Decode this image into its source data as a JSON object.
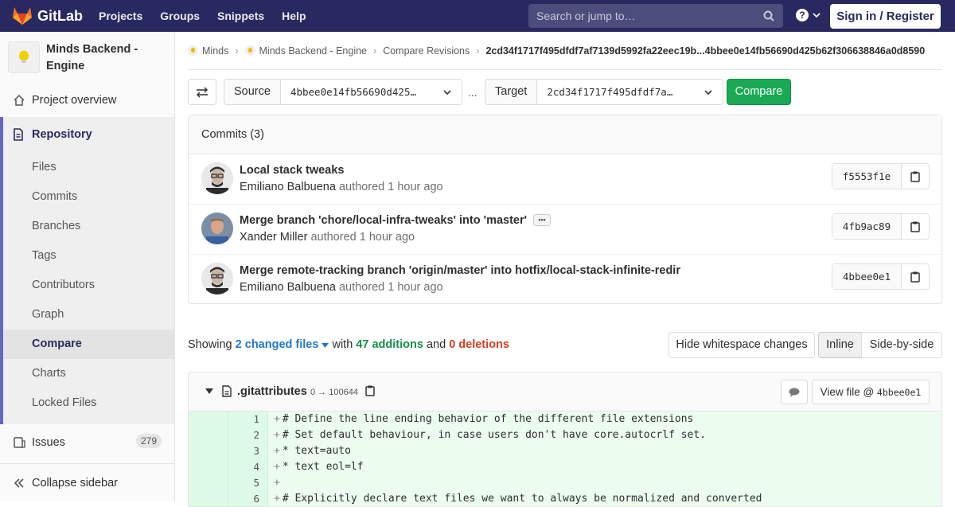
{
  "navbar": {
    "brand": "GitLab",
    "links": [
      "Projects",
      "Groups",
      "Snippets",
      "Help"
    ],
    "search_placeholder": "Search or jump to…",
    "help_label": "?",
    "signin_label": "Sign in / Register"
  },
  "sidebar": {
    "project_name": "Minds Backend - Engine",
    "project_overview": "Project overview",
    "repository": "Repository",
    "repo_items": [
      "Files",
      "Commits",
      "Branches",
      "Tags",
      "Contributors",
      "Graph",
      "Compare",
      "Charts",
      "Locked Files"
    ],
    "active_item": "Compare",
    "issues": "Issues",
    "issues_count": "279",
    "collapse": "Collapse sidebar"
  },
  "breadcrumb": {
    "items": [
      "Minds",
      "Minds Backend - Engine",
      "Compare Revisions"
    ],
    "current": "2cd34f1717f495dfdf7af7139d5992fa22eec19b...4bbee0e14fb56690d425b62f306638846a0d8590"
  },
  "compare": {
    "source_label": "Source",
    "source_value": "4bbee0e14fb56690d425…",
    "dots": "...",
    "target_label": "Target",
    "target_value": "2cd34f1717f495dfdf7a…",
    "button": "Compare"
  },
  "commits": {
    "header": "Commits (3)",
    "rows": [
      {
        "title": "Local stack tweaks",
        "author": "Emiliano Balbuena",
        "authored": "authored",
        "time": "1 hour ago",
        "sha": "f5553f1e",
        "has_more": false
      },
      {
        "title": "Merge branch 'chore/local-infra-tweaks' into 'master'",
        "author": "Xander Miller",
        "authored": "authored",
        "time": "1 hour ago",
        "sha": "4fb9ac89",
        "has_more": true
      },
      {
        "title": "Merge remote-tracking branch 'origin/master' into hotfix/local-stack-infinite-redir",
        "author": "Emiliano Balbuena",
        "authored": "authored",
        "time": "1 hour ago",
        "sha": "4bbee0e1",
        "has_more": false
      }
    ]
  },
  "stats": {
    "showing": "Showing",
    "changed_files": "2 changed files",
    "with": "with",
    "additions": "47 additions",
    "and": "and",
    "deletions": "0 deletions"
  },
  "view_options": {
    "hide_whitespace": "Hide whitespace changes",
    "inline": "Inline",
    "side_by_side": "Side-by-side",
    "active": "Inline"
  },
  "file": {
    "name": ".gitattributes",
    "mode": "0 → 100644",
    "view_file_label": "View file @",
    "view_file_sha": "4bbee0e1",
    "lines": [
      {
        "num": "1",
        "text": "# Define the line ending behavior of the different file extensions"
      },
      {
        "num": "2",
        "text": "# Set default behaviour, in case users don't have core.autocrlf set."
      },
      {
        "num": "3",
        "text": "* text=auto"
      },
      {
        "num": "4",
        "text": "* text eol=lf"
      },
      {
        "num": "5",
        "text": ""
      },
      {
        "num": "6",
        "text": "# Explicitly declare text files we want to always be normalized and converted"
      }
    ]
  },
  "colors": {
    "navbar": "#292961",
    "accent": "#6666c4",
    "green": "#1aaa55",
    "additions": "#168f48",
    "deletions": "#db3b21",
    "link": "#1f78d1"
  }
}
